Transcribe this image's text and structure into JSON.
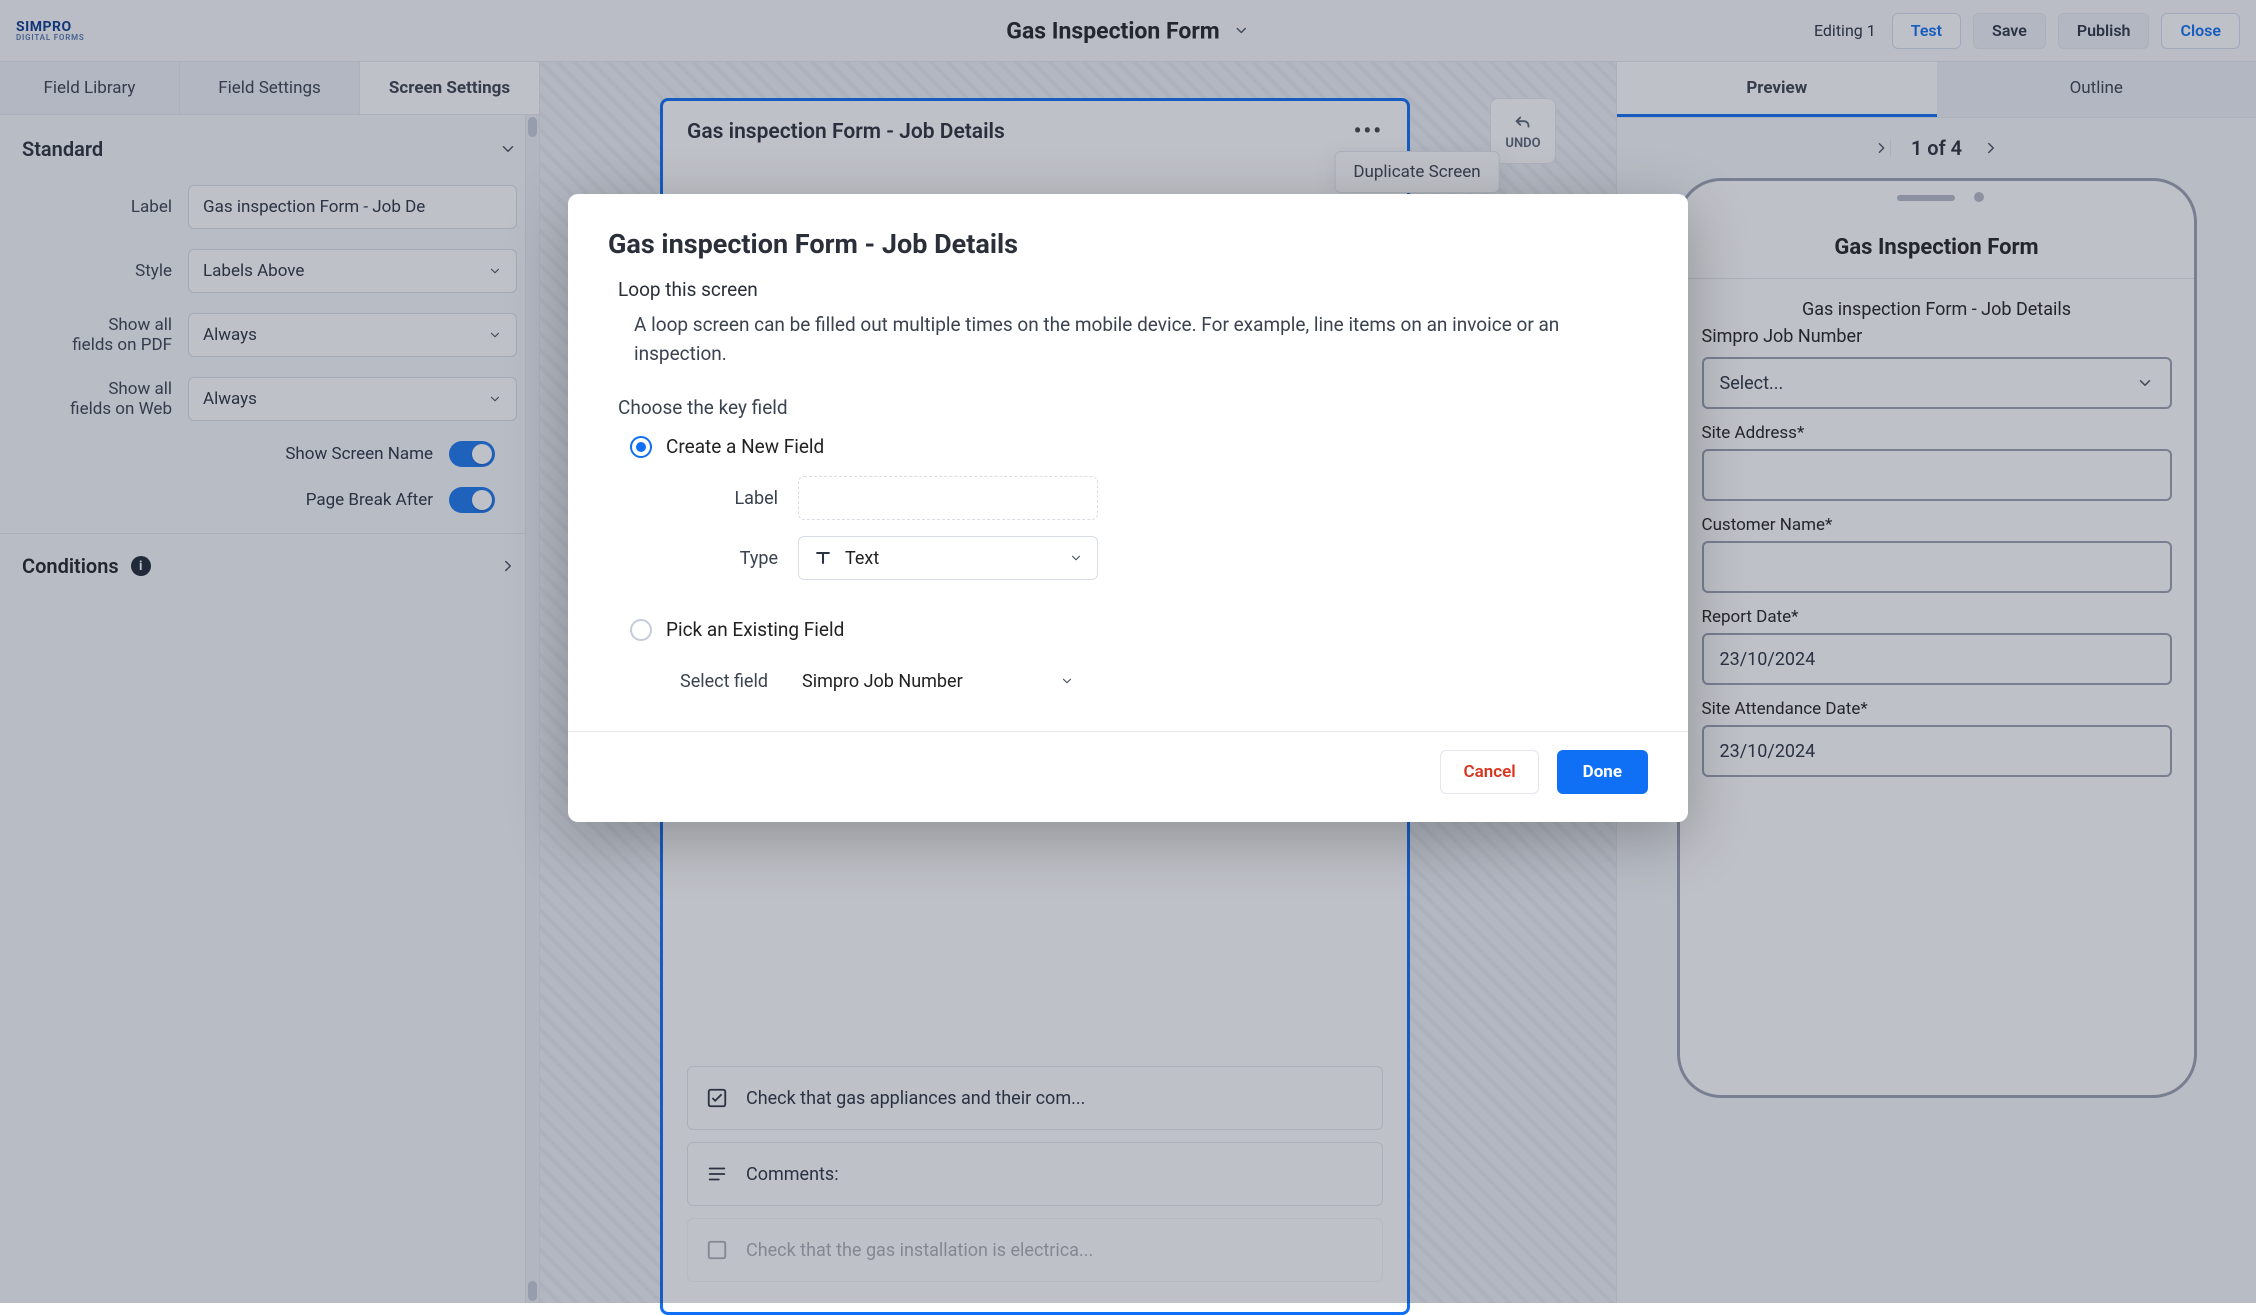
{
  "brand": {
    "name": "SIMPRO",
    "sub": "DIGITAL FORMS"
  },
  "title": "Gas Inspection Form",
  "top": {
    "editing": "Editing 1",
    "test": "Test",
    "save": "Save",
    "publish": "Publish",
    "close": "Close"
  },
  "leftTabs": {
    "library": "Field Library",
    "settings": "Field Settings",
    "screen": "Screen Settings"
  },
  "standard": {
    "header": "Standard",
    "labelLabel": "Label",
    "labelValue": "Gas inspection Form - Job De",
    "styleLabel": "Style",
    "styleValue": "Labels Above",
    "pdfLabel1": "Show all",
    "pdfLabel2": "fields on PDF",
    "pdfValue": "Always",
    "webLabel1": "Show all",
    "webLabel2": "fields on Web",
    "webValue": "Always",
    "showName": "Show Screen Name",
    "pageBreak": "Page Break After",
    "conditions": "Conditions"
  },
  "canvas": {
    "title": "Gas inspection Form - Job Details",
    "tooltip": "Duplicate Screen",
    "undo": "UNDO",
    "items": [
      {
        "label": "Check that gas appliances and their com..."
      },
      {
        "label": "Comments:"
      },
      {
        "label": "Check that the gas installation is electrica..."
      }
    ]
  },
  "rightTabs": {
    "preview": "Preview",
    "outline": "Outline",
    "pager": "1 of 4"
  },
  "phone": {
    "title": "Gas Inspection Form",
    "subtitle": "Gas inspection Form - Job Details",
    "jobNumber": "Simpro Job Number",
    "select": "Select...",
    "siteAddress": "Site Address*",
    "customerName": "Customer Name*",
    "reportDate": "Report Date*",
    "reportDateVal": "23/10/2024",
    "attDate": "Site Attendance Date*",
    "attDateVal": "23/10/2024"
  },
  "modal": {
    "title": "Gas inspection Form - Job Details",
    "loop": "Loop this screen",
    "loopDesc": "A loop screen can be filled out multiple times on the mobile device. For example, line items on an invoice or an inspection.",
    "choose": "Choose the key field",
    "optCreate": "Create a New Field",
    "label": "Label",
    "type": "Type",
    "typeVal": "Text",
    "optPick": "Pick an Existing Field",
    "selectField": "Select field",
    "selectFieldVal": "Simpro Job Number",
    "cancel": "Cancel",
    "done": "Done"
  }
}
